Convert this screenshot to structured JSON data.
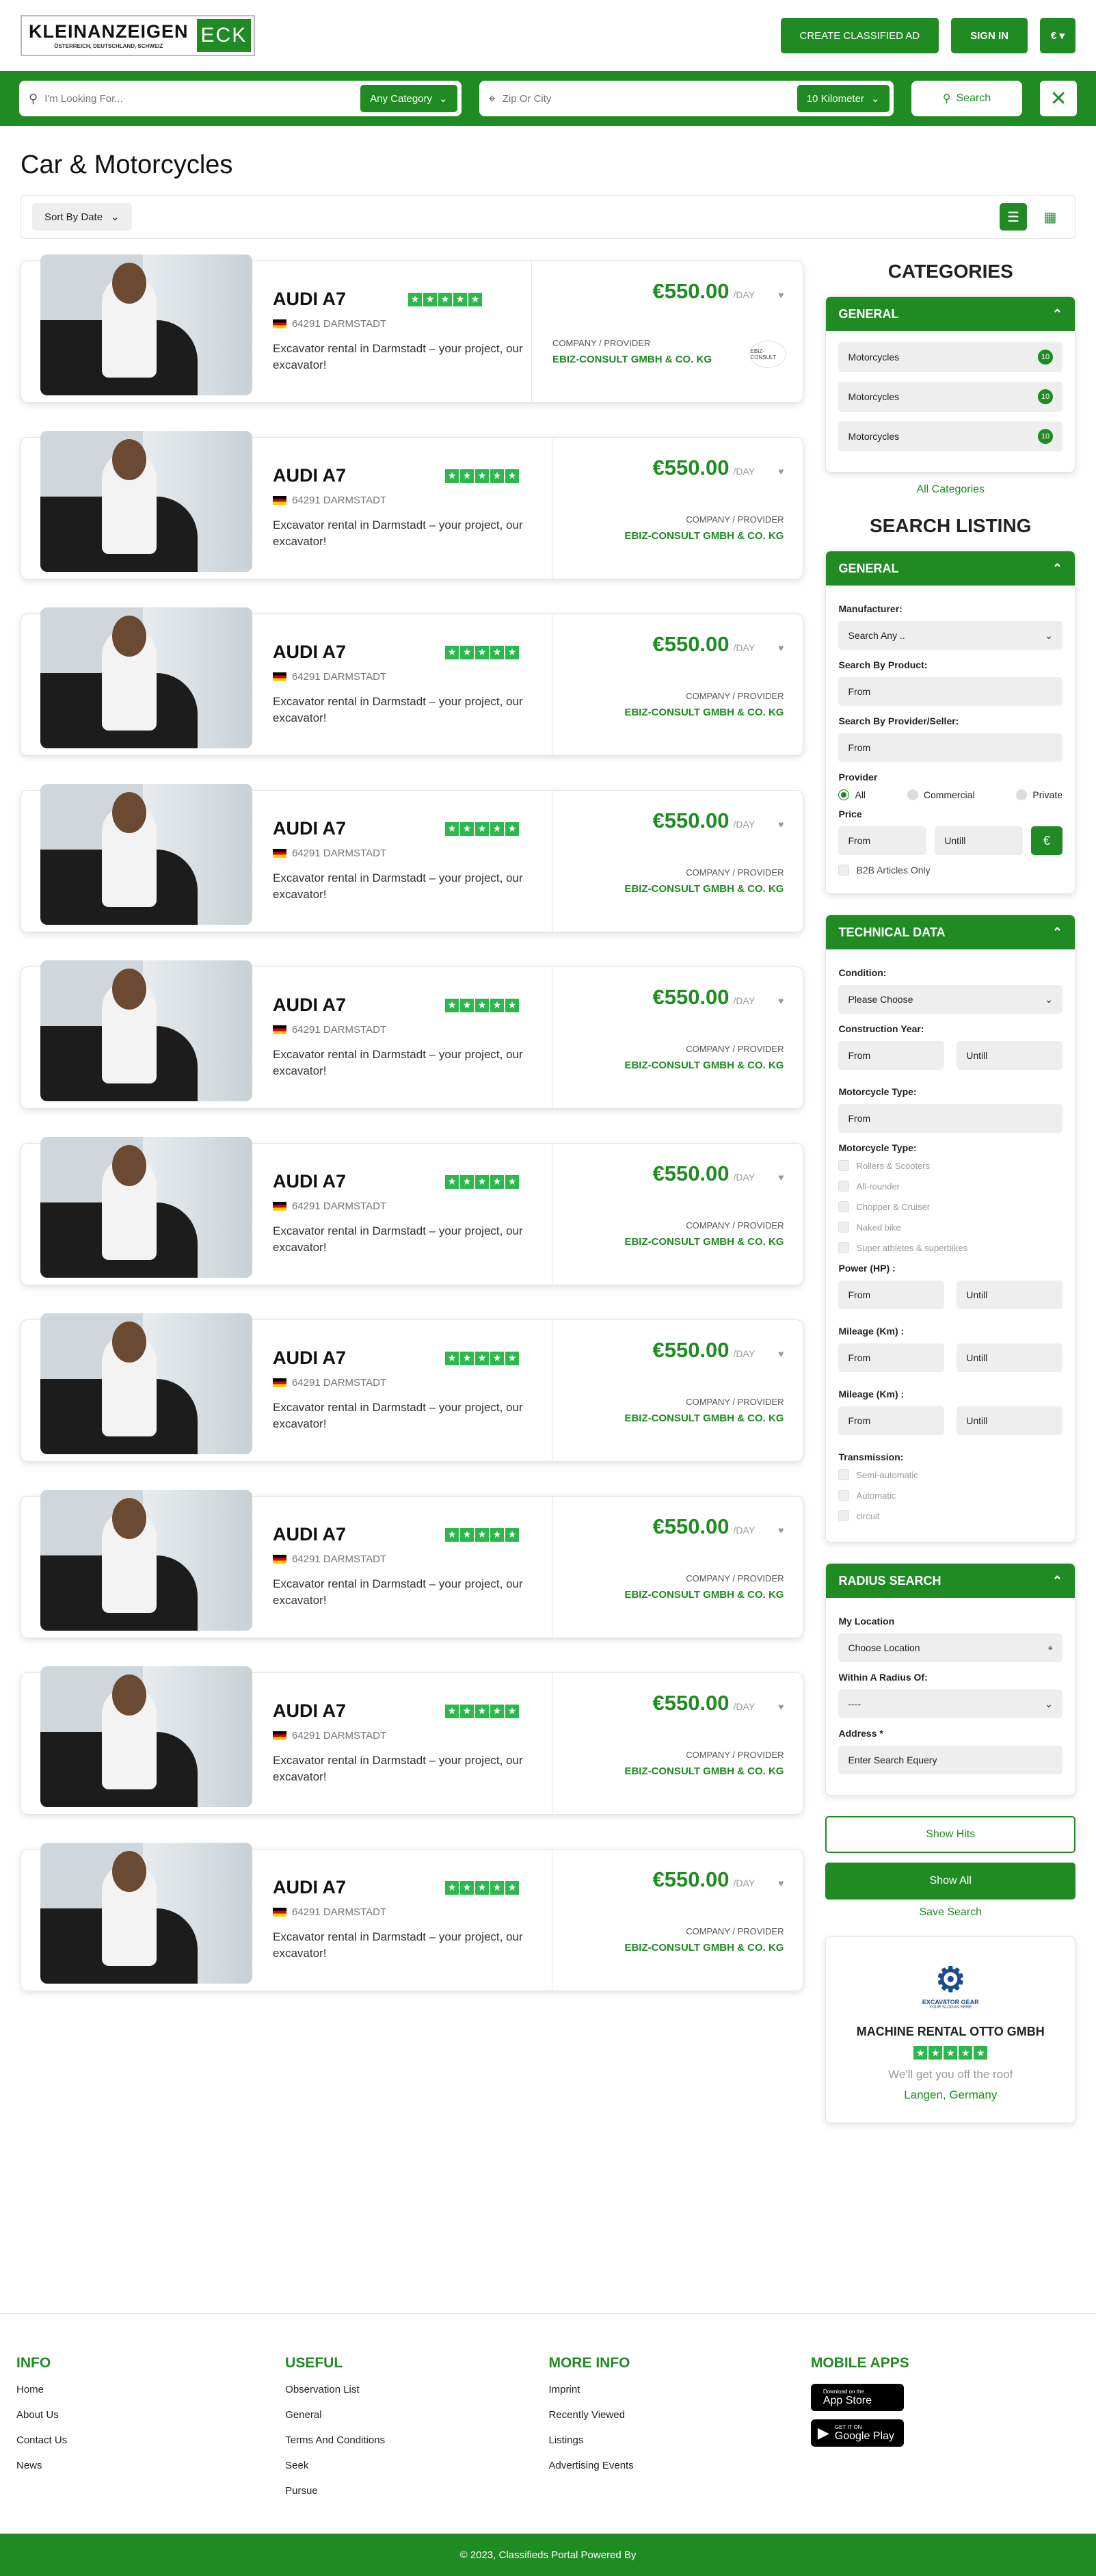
{
  "brand": {
    "logo_main": "KLEINANZEIGEN",
    "logo_accent": "ECK",
    "logo_sub": "ÖSTERREICH, DEUTSCHLAND, SCHWEIZ"
  },
  "header": {
    "create_ad": "CREATE CLASSIFIED AD",
    "sign_in": "SIGN IN",
    "currency": "€ ▾"
  },
  "search": {
    "keyword_placeholder": "I'm Looking For...",
    "category": "Any Category",
    "zip_placeholder": "Zip Or City",
    "radius": "10 Kilometer",
    "search_btn": "Search"
  },
  "page": {
    "title": "Car & Motorcycles",
    "sort": "Sort By Date"
  },
  "listing": {
    "title": "AUDI A7",
    "location": "64291 DARMSTADT",
    "description": "Excavator rental in Darmstadt – your project, our excavator!",
    "price": "€550.00",
    "price_unit": "/DAY",
    "provider_label": "COMPANY / PROVIDER",
    "provider_name": "EBIZ-CONSULT GMBH & CO. KG",
    "provider_logo": "EBIZ-CONSULT"
  },
  "sidebar": {
    "categories_title": "CATEGORIES",
    "general": "GENERAL",
    "categories": [
      {
        "label": "Motorcycles",
        "count": "10"
      },
      {
        "label": "Motorcycles",
        "count": "10"
      },
      {
        "label": "Motorcycles",
        "count": "10"
      }
    ],
    "all_categories": "All Categories",
    "search_title": "SEARCH LISTING",
    "manufacturer": "Manufacturer:",
    "search_any": "Search Any ..",
    "by_product": "Search By Product:",
    "by_provider": "Search By Provider/Seller:",
    "from": "From",
    "untill": "Untill",
    "provider": "Provider",
    "all": "All",
    "commercial": "Commercial",
    "private": "Private",
    "price": "Price",
    "eur": "€",
    "b2b": "B2B Articles Only",
    "tech_title": "TECHNICAL DATA",
    "condition": "Condition:",
    "please_choose": "Please Choose",
    "construction_year": "Construction Year:",
    "moto_type": "Motorcycle Type:",
    "moto_types": [
      "Rollers & Scooters",
      "All-rounder",
      "Chopper & Cruiser",
      "Naked bike",
      "Super athletes & superbikes"
    ],
    "power": "Power (HP) :",
    "mileage": "Mileage (Km) :",
    "transmission": "Transmission:",
    "transmissions": [
      "Semi-automatic",
      "Automatic",
      "circuit"
    ],
    "radius_title": "RADIUS SEARCH",
    "my_location": "My Location",
    "choose_location": "Choose Location",
    "within_radius": "Within A Radius Of:",
    "radius_val": "----",
    "address": "Address *",
    "address_ph": "Enter Search Equery",
    "show_hits": "Show Hits",
    "show_all": "Show All",
    "save_search": "Save Search"
  },
  "company": {
    "logo_text": "EXCAVATOR GEAR",
    "logo_sub": "YOUR SLOGAN HERE",
    "name": "MACHINE RENTAL OTTO GMBH",
    "tagline": "We'll get you off the roof",
    "location": "Langen, Germany"
  },
  "footer": {
    "info": {
      "title": "INFO",
      "links": [
        "Home",
        "About Us",
        "Contact Us",
        "News"
      ]
    },
    "useful": {
      "title": "USEFUL",
      "links": [
        "Observation List",
        "General",
        "Terms And Conditions",
        "Seek",
        "Pursue"
      ]
    },
    "more": {
      "title": "MORE INFO",
      "links": [
        "Imprint",
        "Recently Viewed",
        "Listings",
        "Advertising Events"
      ]
    },
    "apps": {
      "title": "MOBILE APPS",
      "appstore_small": "Download on the",
      "appstore": "App Store",
      "gplay_small": "GET IT ON",
      "gplay": "Google Play"
    },
    "copyright": "© 2023, Classifieds Portal Powered By"
  }
}
